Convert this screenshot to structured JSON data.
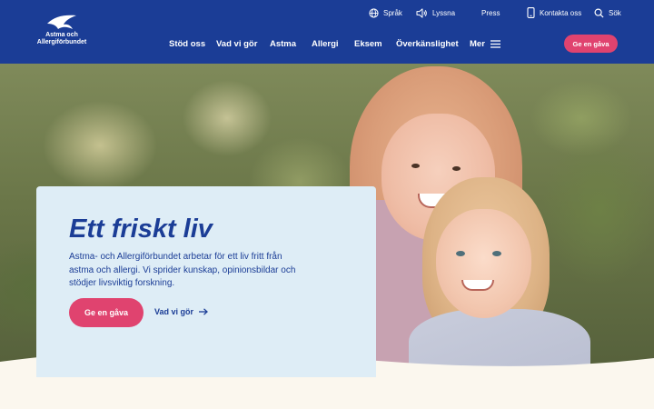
{
  "brand": {
    "name_line1": "Astma och",
    "name_line2": "Allergiförbundet",
    "logo_icon": "swallow-bird-icon"
  },
  "utility_nav": {
    "language": {
      "label": "Språk",
      "icon": "globe-icon"
    },
    "listen": {
      "label": "Lyssna",
      "icon": "speaker-icon"
    },
    "press": {
      "label": "Press"
    },
    "contact": {
      "label": "Kontakta oss",
      "icon": "phone-icon"
    },
    "search": {
      "label": "Sök",
      "icon": "search-icon"
    }
  },
  "main_nav": {
    "items": [
      {
        "label": "Stöd oss"
      },
      {
        "label": "Vad vi gör"
      },
      {
        "label": "Astma"
      },
      {
        "label": "Allergi"
      },
      {
        "label": "Eksem"
      },
      {
        "label": "Överkänslighet"
      }
    ],
    "more": {
      "label": "Mer",
      "icon": "hamburger-menu-icon"
    },
    "donate_button": "Ge en gåva"
  },
  "hero": {
    "image": "two-smiling-girls-photo",
    "title": "Ett friskt liv",
    "body": "Astma- och Allergiförbundet arbetar för ett liv fritt från astma och allergi. Vi sprider kunskap, opinionsbildar och stödjer livsviktig forskning.",
    "primary_button": "Ge en gåva",
    "secondary_link": "Vad vi gör",
    "secondary_link_icon": "arrow-right-icon"
  },
  "colors": {
    "primary_blue": "#1b3d96",
    "accent_pink": "#e0436f",
    "card_bg": "#deedf6",
    "page_bg": "#fbf7ee"
  }
}
